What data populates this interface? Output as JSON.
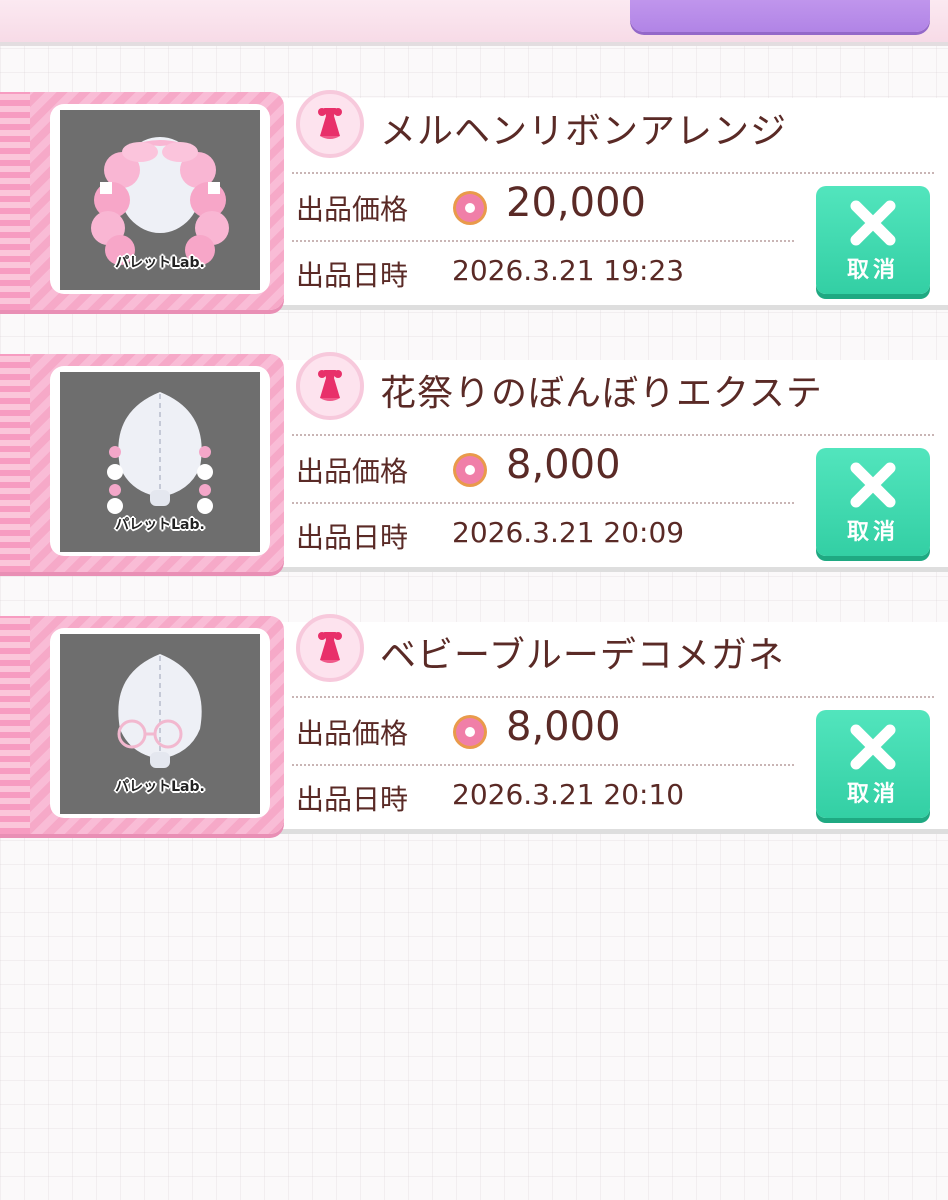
{
  "header": {
    "top_button_label": ""
  },
  "listings": [
    {
      "name": "メルヘンリボンアレンジ",
      "price_label": "出品価格",
      "price": "20,000",
      "date_label": "出品日時",
      "date": "2026.3.21 19:23",
      "thumb_watermark": "パレットLab.",
      "cancel_label": "取消",
      "item_kind": "hair"
    },
    {
      "name": "花祭りのぼんぼりエクステ",
      "price_label": "出品価格",
      "price": "8,000",
      "date_label": "出品日時",
      "date": "2026.3.21 20:09",
      "thumb_watermark": "パレットLab.",
      "cancel_label": "取消",
      "item_kind": "extension"
    },
    {
      "name": "ベビーブルーデコメガネ",
      "price_label": "出品価格",
      "price": "8,000",
      "date_label": "出品日時",
      "date": "2026.3.21 20:10",
      "thumb_watermark": "パレットLab.",
      "cancel_label": "取消",
      "item_kind": "glasses"
    }
  ],
  "icons": {
    "category": "dress-icon",
    "currency": "donut-icon",
    "cancel": "close-x-icon"
  },
  "colors": {
    "accent_pink": "#f6a9c8",
    "cancel_green": "#33cfa4",
    "text_brown": "#5a2a26",
    "top_button_purple": "#b184e6"
  }
}
